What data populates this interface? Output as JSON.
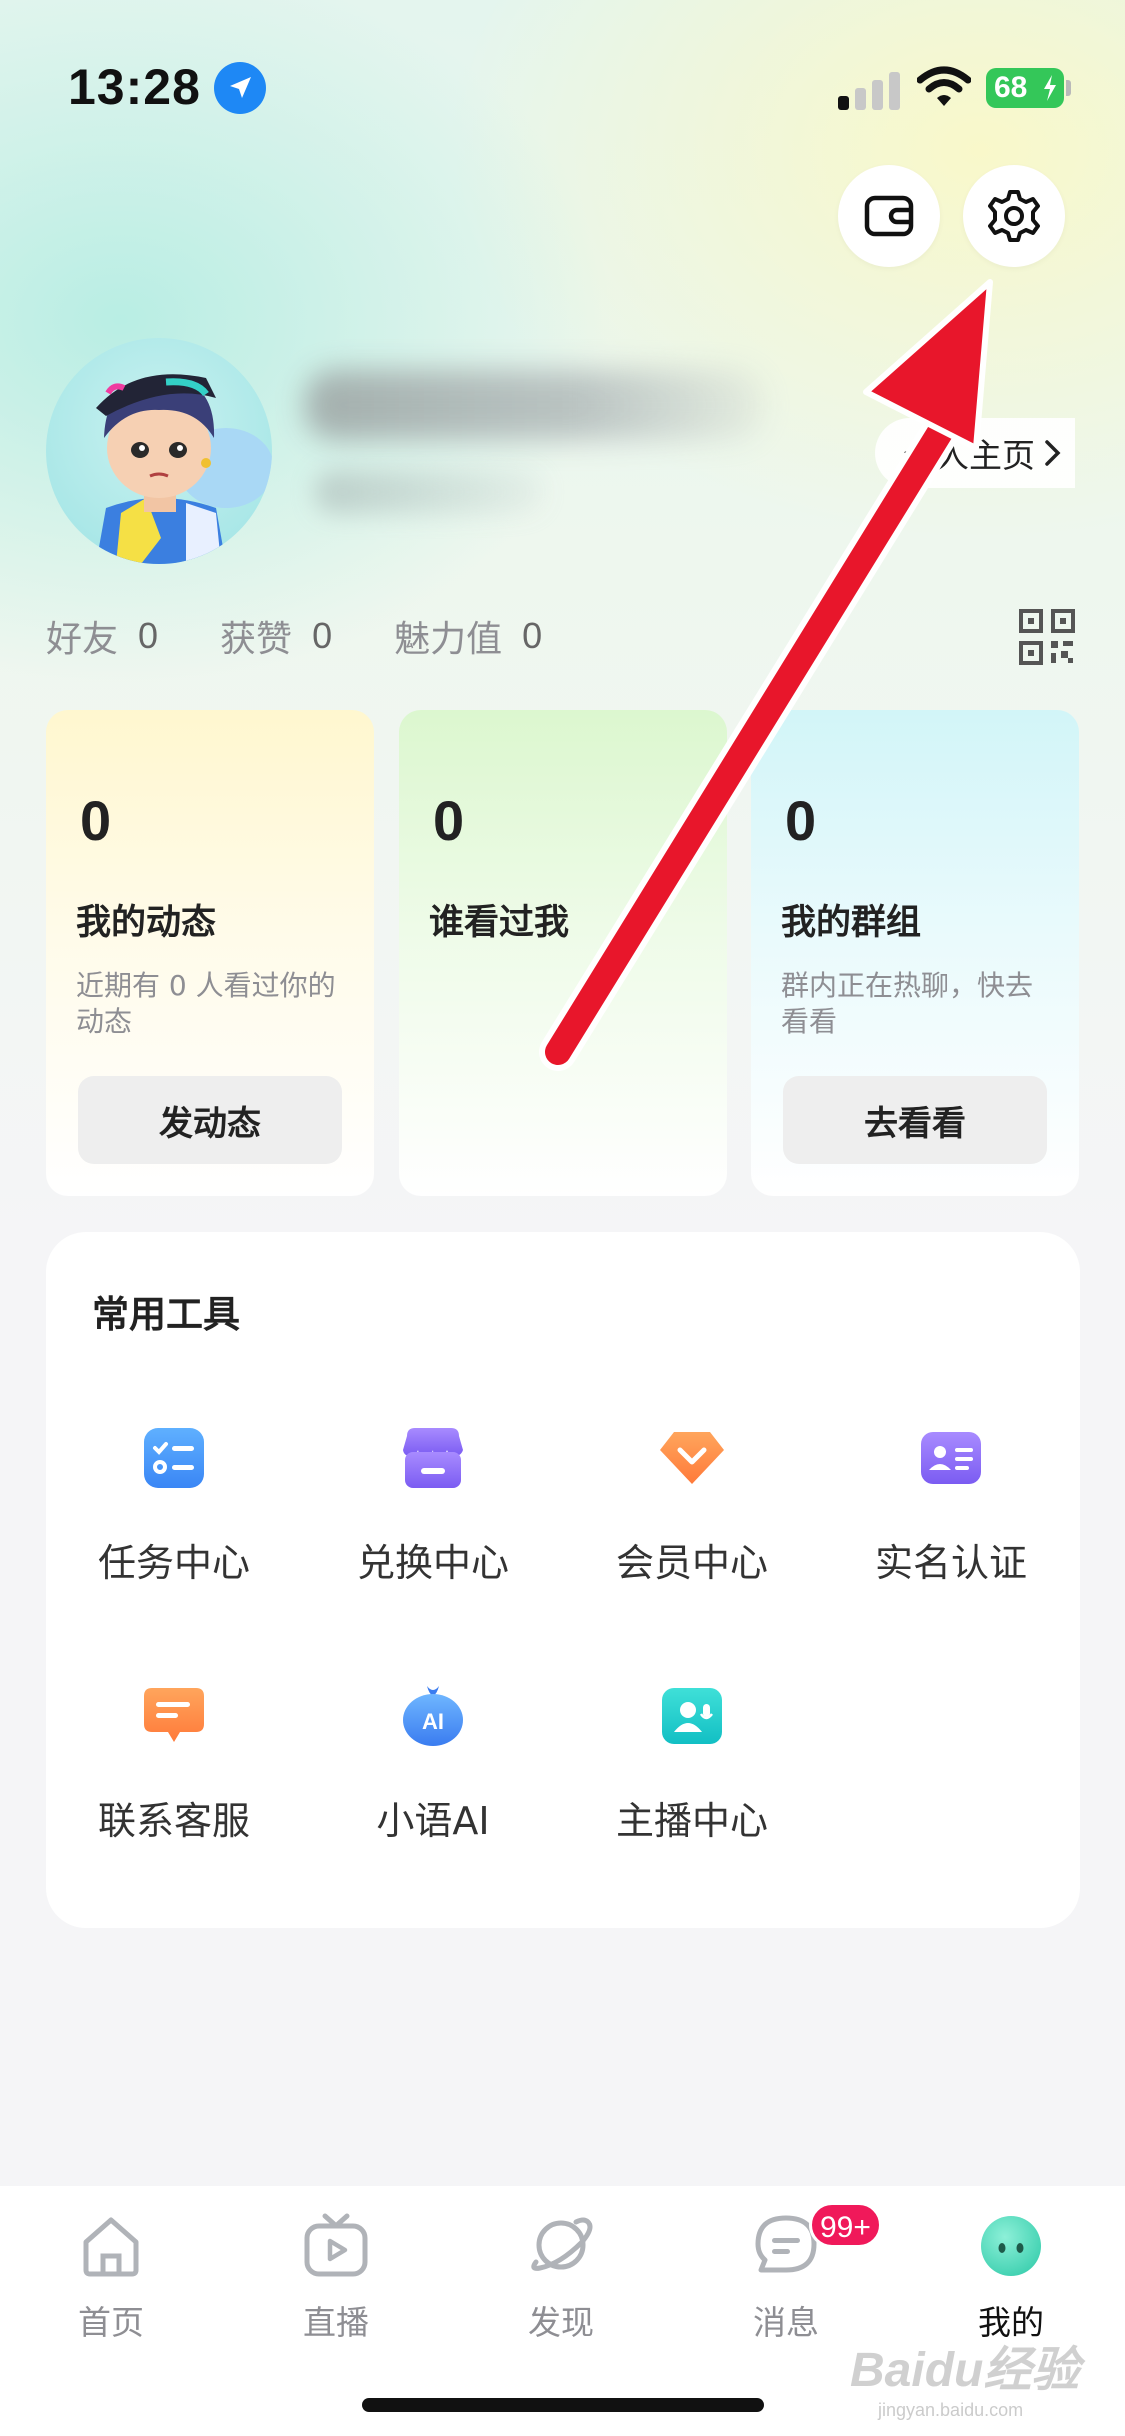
{
  "status_bar": {
    "time": "13:28",
    "battery": "68"
  },
  "header": {
    "wallet_icon": "wallet-icon",
    "settings_icon": "gear-icon"
  },
  "profile": {
    "homepage_label": "个人主页",
    "stats": [
      {
        "label": "好友",
        "value": "0"
      },
      {
        "label": "获赞",
        "value": "0"
      },
      {
        "label": "魅力值",
        "value": "0"
      }
    ]
  },
  "cards": [
    {
      "count": "0",
      "title": "我的动态",
      "desc": "近期有 0 人看过你的动态",
      "button": "发动态"
    },
    {
      "count": "0",
      "title": "谁看过我"
    },
    {
      "count": "0",
      "title": "我的群组",
      "desc": "群内正在热聊，快去看看",
      "button": "去看看"
    }
  ],
  "tools": {
    "title": "常用工具",
    "items": [
      {
        "label": "任务中心",
        "icon": "task-icon"
      },
      {
        "label": "兑换中心",
        "icon": "store-icon"
      },
      {
        "label": "会员中心",
        "icon": "vip-icon"
      },
      {
        "label": "实名认证",
        "icon": "id-card-icon"
      },
      {
        "label": "联系客服",
        "icon": "chat-icon"
      },
      {
        "label": "小语AI",
        "icon": "ai-icon"
      },
      {
        "label": "主播中心",
        "icon": "anchor-icon"
      }
    ]
  },
  "tabbar": {
    "items": [
      {
        "label": "首页",
        "icon": "home-icon"
      },
      {
        "label": "直播",
        "icon": "tv-icon"
      },
      {
        "label": "发现",
        "icon": "planet-icon"
      },
      {
        "label": "消息",
        "icon": "message-icon",
        "badge": "99+"
      },
      {
        "label": "我的",
        "icon": "avatar-icon",
        "active": true
      }
    ]
  },
  "watermark": {
    "brand": "Baidu经验",
    "url": "jingyan.baidu.com"
  },
  "colors": {
    "accent_red": "#e8162b",
    "badge": "#f0195a",
    "battery": "#34c759"
  }
}
